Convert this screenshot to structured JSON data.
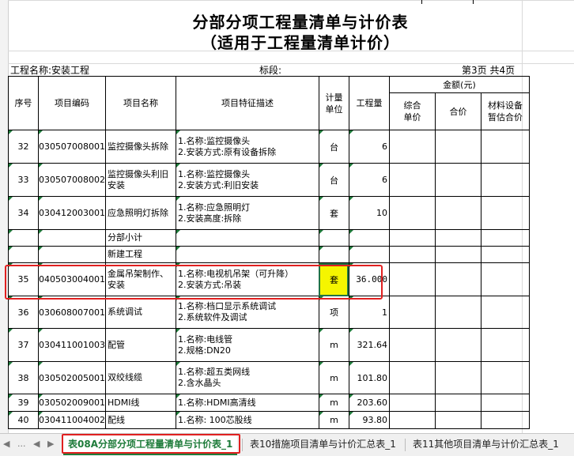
{
  "title": {
    "line1": "分部分项工程量清单与计价表",
    "line2": "（适用于工程量清单计价）"
  },
  "info": {
    "project": "工程名称:安装工程",
    "section": "标段:",
    "page": "第3页 共4页"
  },
  "header": {
    "seq": "序号",
    "code": "项目编码",
    "name": "项目名称",
    "desc": "项目特征描述",
    "unit_a": "计量",
    "unit_b": "单位",
    "qty": "工程量",
    "amount": "金额(元)",
    "unit_price_a": "综合",
    "unit_price_b": "单价",
    "total": "合价",
    "equip_a": "材料设备",
    "equip_b": "暂估合价"
  },
  "rows": [
    {
      "seq": "32",
      "code": "030507008001",
      "name1": "监控摄像头拆除",
      "name2": "",
      "desc1": "1.名称:监控摄像头",
      "desc2": "2.安装方式:原有设备拆除",
      "unit": "台",
      "qty": "6"
    },
    {
      "seq": "33",
      "code": "030507008002",
      "name1": "监控摄像头利旧",
      "name2": "安装",
      "desc1": "1.名称:监控摄像头",
      "desc2": "2.安装方式:利旧安装",
      "unit": "台",
      "qty": "6"
    },
    {
      "seq": "34",
      "code": "030412003001",
      "name1": "应急照明灯拆除",
      "name2": "",
      "desc1": "1.名称:应急照明灯",
      "desc2": "2.安装高度:拆除",
      "unit": "套",
      "qty": "10"
    },
    {
      "seq": "",
      "code": "",
      "name1": "分部小计",
      "name2": "",
      "desc1": "",
      "desc2": "",
      "unit": "",
      "qty": ""
    },
    {
      "seq": "",
      "code": "",
      "name1": "新建工程",
      "name2": "",
      "desc1": "",
      "desc2": "",
      "unit": "",
      "qty": ""
    },
    {
      "seq": "35",
      "code": "040503004001",
      "name1": "金属吊架制作、",
      "name2": "安装",
      "desc1": "1.名称:电视机吊架（可升降）",
      "desc2": "2.安装方式:吊装",
      "unit": "套",
      "qty": "36.000"
    },
    {
      "seq": "36",
      "code": "030608007001",
      "name1": "系统调试",
      "name2": "",
      "desc1": "1.名称:档口显示系统调试",
      "desc2": "2.系统软件及调试",
      "unit": "项",
      "qty": "1"
    },
    {
      "seq": "37",
      "code": "030411001003",
      "name1": "配管",
      "name2": "",
      "desc1": "1.名称:电线管",
      "desc2": "2.规格:DN20",
      "unit": "m",
      "qty": "321.64"
    },
    {
      "seq": "38",
      "code": "030502005001",
      "name1": "双绞线缆",
      "name2": "",
      "desc1": "1.名称:超五类网线",
      "desc2": "2.含水晶头",
      "unit": "m",
      "qty": "101.80"
    },
    {
      "seq": "39",
      "code": "030502009001",
      "name1": "HDMI线",
      "name2": "",
      "desc1": "1.名称:HDMI高清线",
      "desc2": "",
      "unit": "m",
      "qty": "203.60"
    },
    {
      "seq": "40",
      "code": "030411004002",
      "name1": "配线",
      "name2": "",
      "desc1": "1.名称: 100芯股线",
      "desc2": "",
      "unit": "m",
      "qty": "93.80"
    }
  ],
  "tabs": [
    {
      "label": "表08A分部分项工程量清单与计价表_1"
    },
    {
      "label": "表10措施项目清单与计价汇总表_1"
    },
    {
      "label": "表11其他项目清单与计价汇总表_1"
    }
  ],
  "nav": {
    "more": "..."
  },
  "colors": {
    "selected_cell": "#f5f500",
    "highlight_box": "#e02020",
    "active_tab": "#1e7b3a"
  }
}
